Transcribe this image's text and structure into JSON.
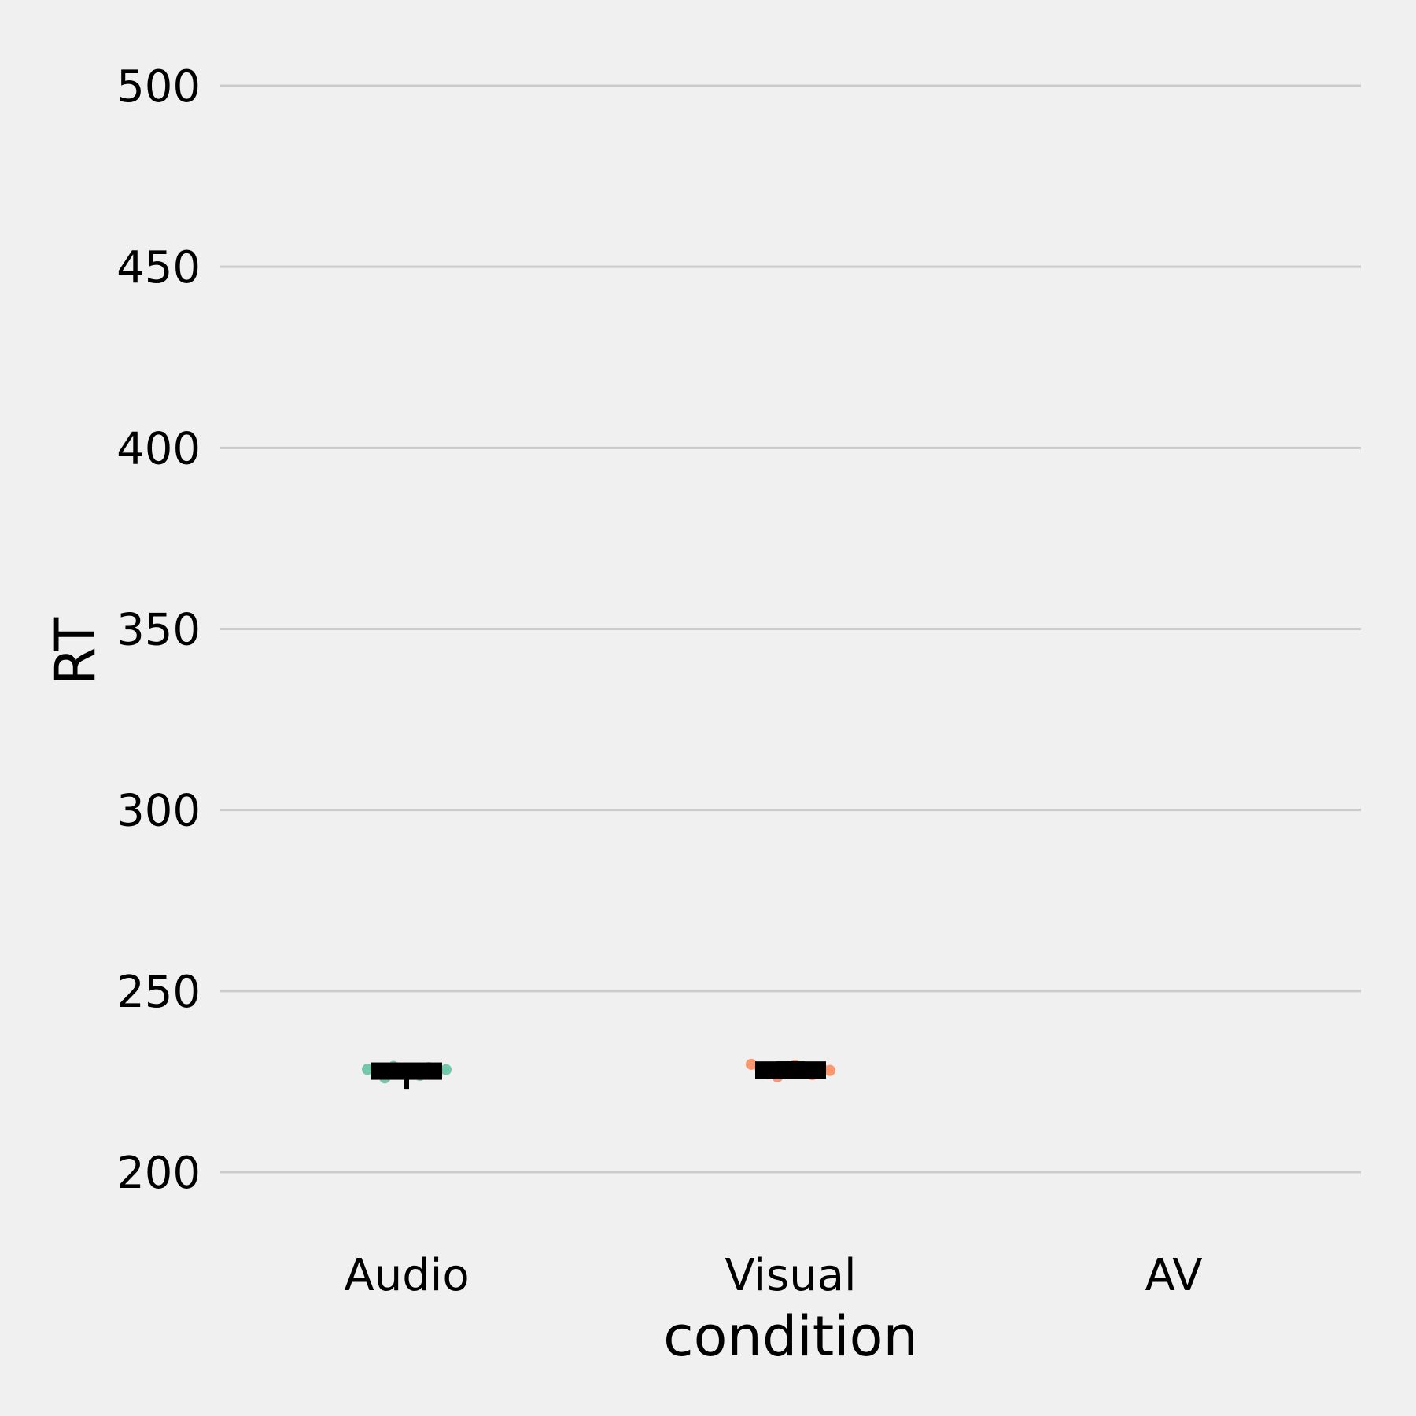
{
  "chart_data": {
    "type": "scatter",
    "xlabel": "condition",
    "ylabel": "RT",
    "ylim": [
      190,
      520
    ],
    "yticks": [
      200,
      250,
      300,
      350,
      400,
      450,
      500
    ],
    "categories": [
      "Audio",
      "Visual",
      "AV"
    ],
    "grid": "horizontal",
    "series": [
      {
        "category": "Audio",
        "color": "#66c2a5",
        "points": [
          228.4,
          227.1,
          226.0,
          229.2,
          228.0,
          227.6,
          226.7,
          228.9,
          227.9,
          228.3
        ],
        "mean": 227.9,
        "ci": [
          226.0,
          229.4
        ],
        "sd_range": [
          223.0,
          229.7
        ]
      },
      {
        "category": "Visual",
        "color": "#fc8d62",
        "points": [
          229.8,
          228.7,
          227.2,
          226.3,
          228.4,
          229.5,
          227.8,
          226.9,
          229.0,
          228.1
        ],
        "mean": 228.2,
        "ci": [
          226.4,
          230.6
        ],
        "sd_range": [
          226.4,
          230.6
        ]
      },
      {
        "category": "AV",
        "color": "#8da0cb",
        "points": []
      }
    ]
  }
}
